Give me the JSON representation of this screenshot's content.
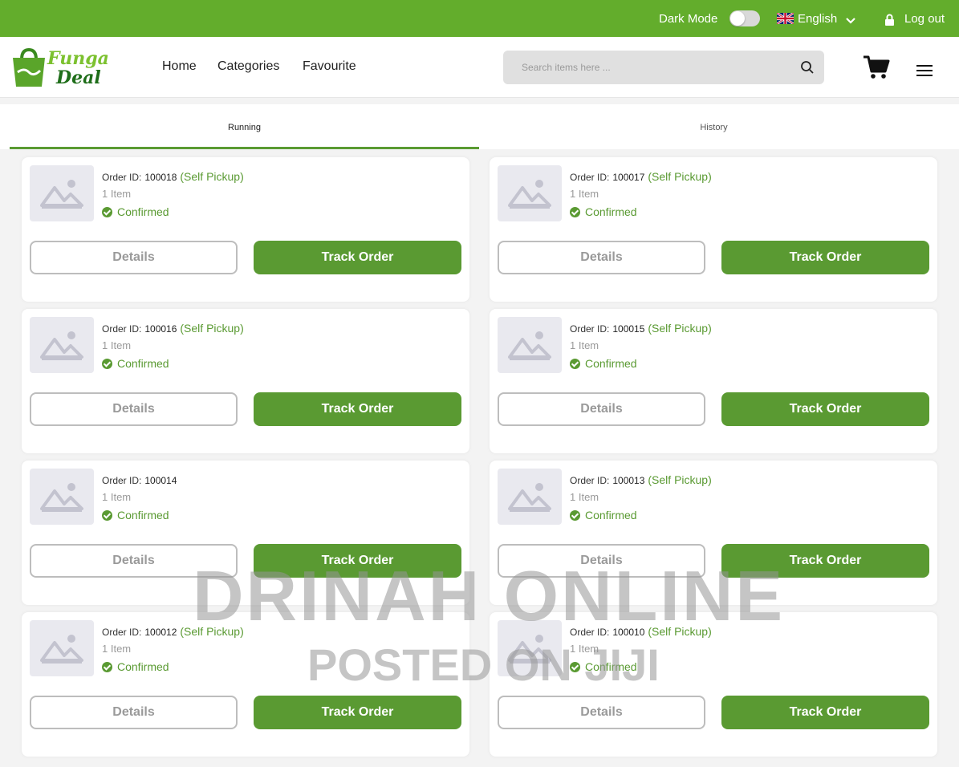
{
  "topbar": {
    "dark_mode_label": "Dark Mode",
    "dark_mode_enabled": false,
    "language": "English",
    "logout_label": "Log out",
    "background": "#63ad2c"
  },
  "header": {
    "logo_line1": "Funga",
    "logo_line2": "Deal",
    "nav": [
      "Home",
      "Categories",
      "Favourite"
    ],
    "search_placeholder": "Search items here ..."
  },
  "tabs": [
    "Running",
    "History"
  ],
  "active_tab": "Running",
  "orders": [
    {
      "label": "Order ID:",
      "id": "100018",
      "pickup": "(Self Pickup)",
      "items": "1 Item",
      "status": "Confirmed",
      "details_label": "Details",
      "track_label": "Track Order"
    },
    {
      "label": "Order ID:",
      "id": "100017",
      "pickup": "(Self Pickup)",
      "items": "1 Item",
      "status": "Confirmed",
      "details_label": "Details",
      "track_label": "Track Order"
    },
    {
      "label": "Order ID:",
      "id": "100016",
      "pickup": "(Self Pickup)",
      "items": "1 Item",
      "status": "Confirmed",
      "details_label": "Details",
      "track_label": "Track Order"
    },
    {
      "label": "Order ID:",
      "id": "100015",
      "pickup": "(Self Pickup)",
      "items": "1 Item",
      "status": "Confirmed",
      "details_label": "Details",
      "track_label": "Track Order"
    },
    {
      "label": "Order ID:",
      "id": "100014",
      "pickup": "",
      "items": "1 Item",
      "status": "Confirmed",
      "details_label": "Details",
      "track_label": "Track Order"
    },
    {
      "label": "Order ID:",
      "id": "100013",
      "pickup": "(Self Pickup)",
      "items": "1 Item",
      "status": "Confirmed",
      "details_label": "Details",
      "track_label": "Track Order"
    },
    {
      "label": "Order ID:",
      "id": "100012",
      "pickup": "(Self Pickup)",
      "items": "1 Item",
      "status": "Confirmed",
      "details_label": "Details",
      "track_label": "Track Order"
    },
    {
      "label": "Order ID:",
      "id": "100010",
      "pickup": "(Self Pickup)",
      "items": "1 Item",
      "status": "Confirmed",
      "details_label": "Details",
      "track_label": "Track Order"
    }
  ],
  "watermark": {
    "line1": "DRINAH ONLINE",
    "line2": "POSTED ON JIJI"
  },
  "colors": {
    "accent": "#5a9a32",
    "topbar": "#63ad2c"
  }
}
